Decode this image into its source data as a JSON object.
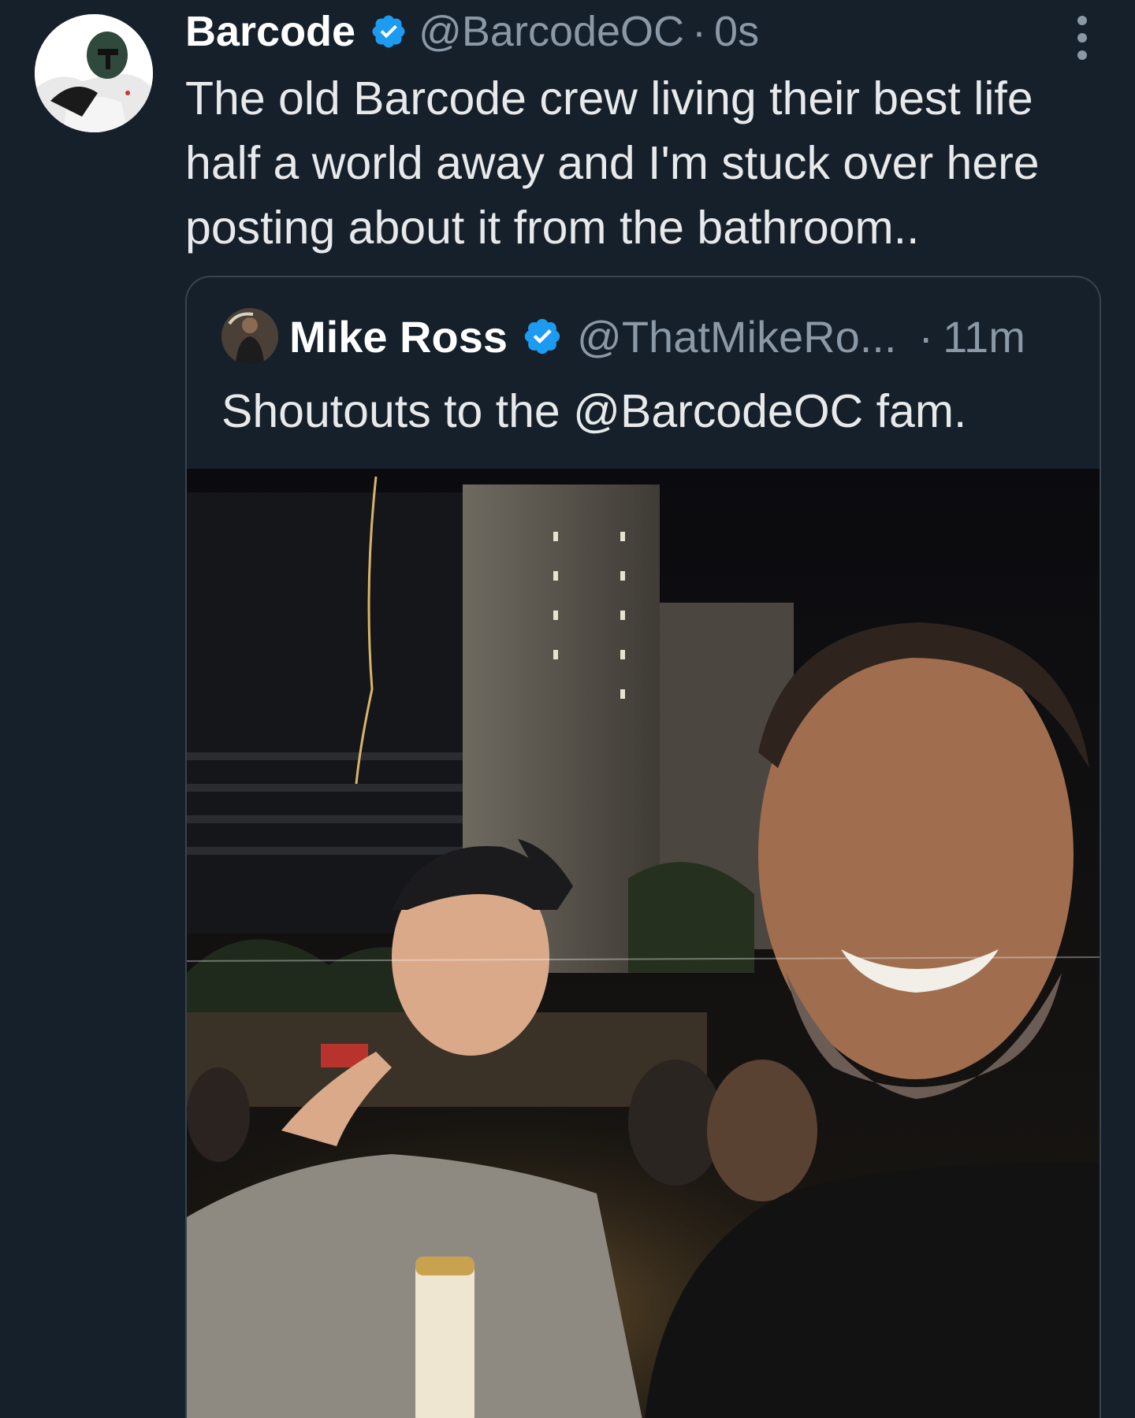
{
  "tweet": {
    "author_name": "Barcode",
    "author_handle": "@BarcodeOC",
    "separator": "·",
    "time": "0s",
    "text_lines": [
      "The old Barcode crew living their best life",
      "half a world away and I'm stuck over here",
      "posting about it from the bathroom.."
    ],
    "avatar_icon": "boba-fett-helmet-avatar",
    "verified_icon": "verified-badge-icon",
    "more_icon": "more-options-icon"
  },
  "quoted_tweet": {
    "author_name": "Mike Ross",
    "author_handle": "@ThatMikeRo...",
    "separator": "·",
    "time": "11m",
    "text": "Shoutouts to the @BarcodeOC fam.",
    "photo_icon": "selfie-photo"
  },
  "colors": {
    "background": "#15202b",
    "verified_blue": "#1d9bf0",
    "secondary_text": "#8b98a5",
    "border": "#38444d"
  }
}
